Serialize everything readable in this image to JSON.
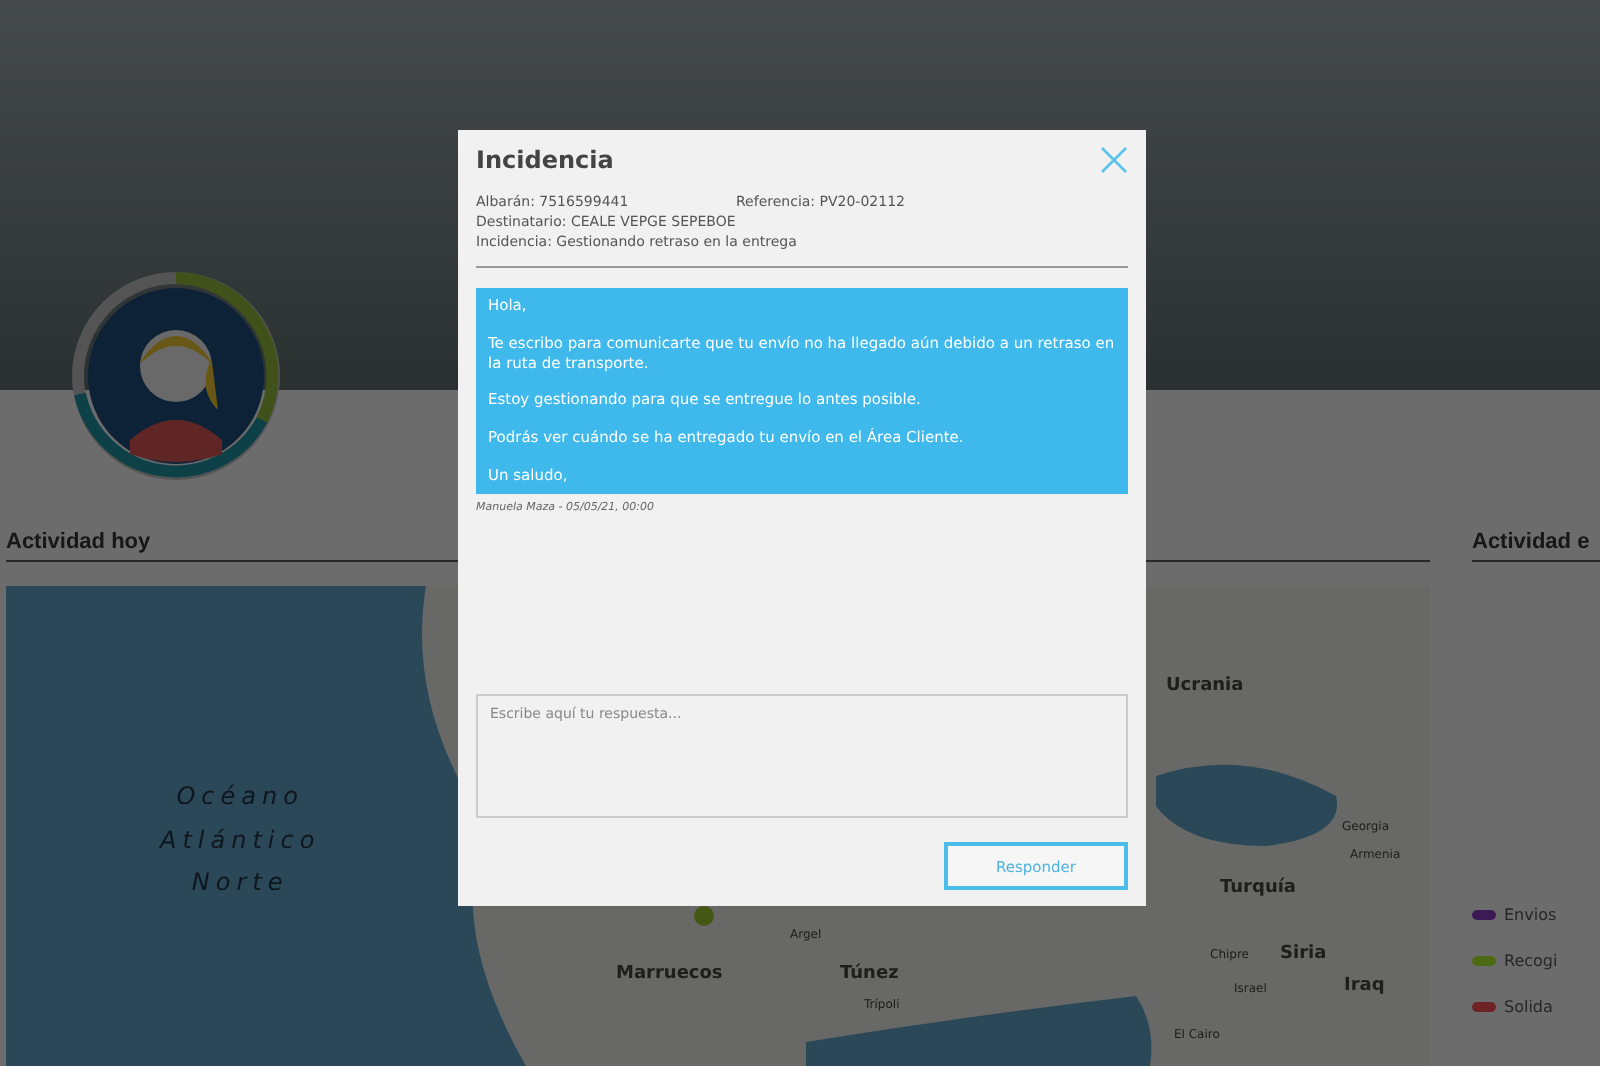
{
  "activity_today": {
    "title": "Actividad hoy",
    "map_labels": [
      {
        "text": "Ucrania",
        "kind": "country"
      },
      {
        "text": "Océano\nAtlántico\nNorte",
        "kind": "ocean"
      },
      {
        "text": "Georgia",
        "kind": "city"
      },
      {
        "text": "Armenia",
        "kind": "city"
      },
      {
        "text": "Turquía",
        "kind": "country"
      },
      {
        "text": "Argel",
        "kind": "city"
      },
      {
        "text": "Chipre",
        "kind": "city"
      },
      {
        "text": "Siria",
        "kind": "country"
      },
      {
        "text": "Marruecos",
        "kind": "country"
      },
      {
        "text": "Túnez",
        "kind": "country"
      },
      {
        "text": "Israel",
        "kind": "city"
      },
      {
        "text": "Iraq",
        "kind": "country"
      },
      {
        "text": "Trípoli",
        "kind": "city"
      },
      {
        "text": "El Cairo",
        "kind": "city"
      }
    ]
  },
  "activity_side": {
    "title": "Actividad e",
    "legend": [
      {
        "label": "Envios",
        "color": "#3b1a55"
      },
      {
        "label": "Recogi",
        "color": "#4d6a14"
      },
      {
        "label": "Solida",
        "color": "#6e2424"
      }
    ]
  },
  "modal": {
    "title": "Incidencia",
    "fields": [
      {
        "label": "Albarán: 7516599441"
      },
      {
        "label": "Referencia: PV20-02112"
      },
      {
        "label": "Destinatario: CEALE VEPGE SEPEBOE"
      },
      {
        "label": "Incidencia: Gestionando retraso en la entrega"
      }
    ],
    "message": {
      "paragraphs": [
        "Hola,",
        "Te escribo para comunicarte que tu envío no ha llegado aún debido a un retraso en la ruta de transporte.",
        "Estoy gestionando para que se entregue lo antes posible.",
        "Podrás ver cuándo se ha entregado tu envío en el Área Cliente.",
        "Un saludo,"
      ],
      "meta": "Manuela Maza - 05/05/21, 00:00"
    },
    "reply": {
      "placeholder": "Escribe aquí tu respuesta..."
    },
    "button": "Responder"
  }
}
